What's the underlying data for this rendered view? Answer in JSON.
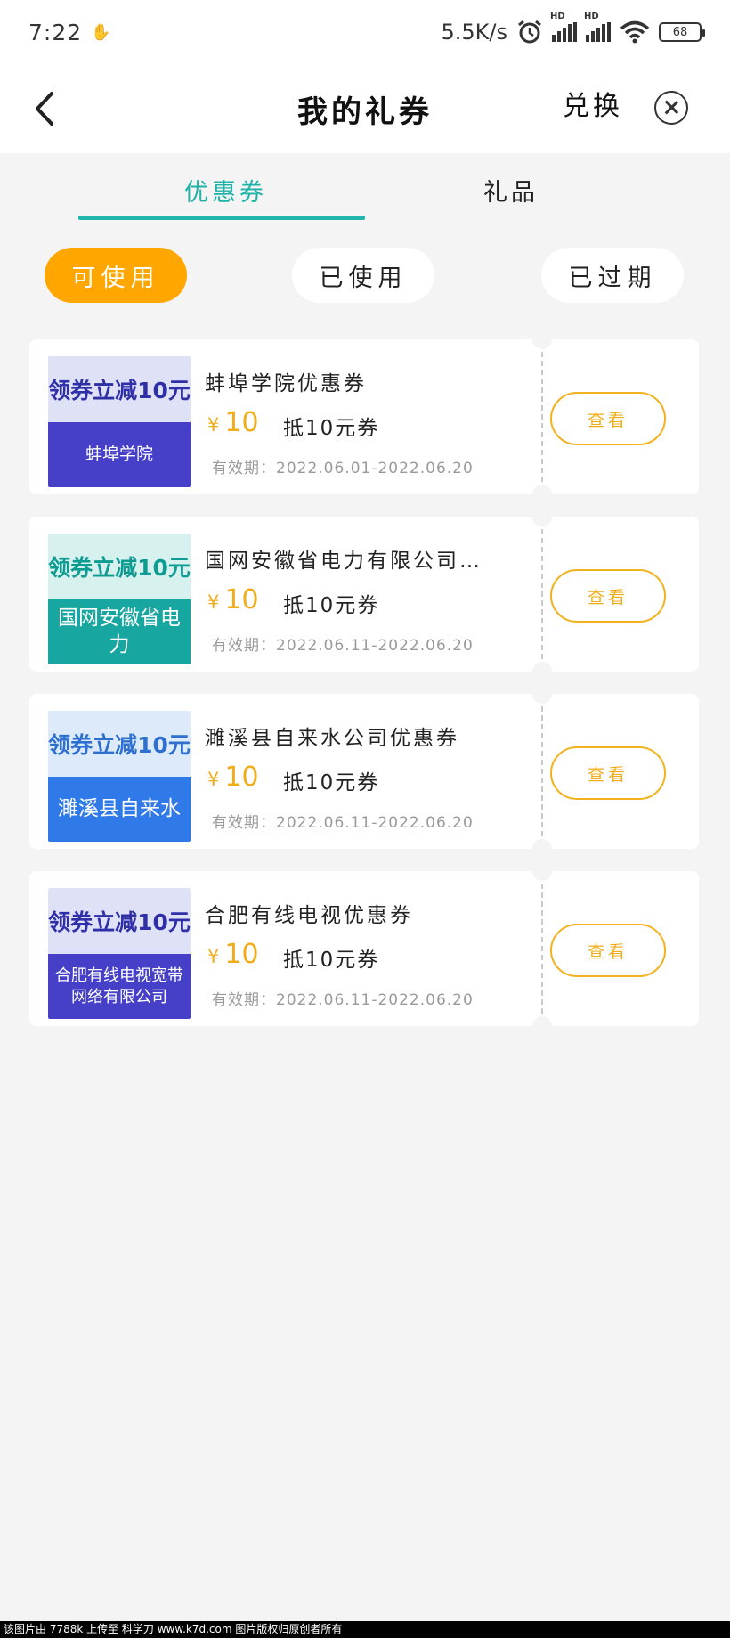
{
  "status_bar": {
    "time": "7:22",
    "speed": "5.5K/s",
    "signal_label_1": "HD",
    "signal_label_2": "HD",
    "battery": "68"
  },
  "header": {
    "title": "我的礼券",
    "exchange_label": "兑换"
  },
  "tabs": [
    {
      "label": "优惠券",
      "active": true
    },
    {
      "label": "礼品",
      "active": false
    }
  ],
  "filters": [
    {
      "label": "可使用",
      "active": true
    },
    {
      "label": "已使用",
      "active": false
    },
    {
      "label": "已过期",
      "active": false
    }
  ],
  "coupons": [
    {
      "thumb_top": "领券立减10元",
      "thumb_bottom": "蚌埠学院",
      "title": "蚌埠学院优惠券",
      "currency": "¥",
      "amount": "10",
      "desc": "抵10元券",
      "valid": "有效期：2022.06.01-2022.06.20",
      "button": "查看"
    },
    {
      "thumb_top": "领券立减10元",
      "thumb_bottom": "国网安徽省电力",
      "title": "国网安徽省电力有限公司…",
      "currency": "¥",
      "amount": "10",
      "desc": "抵10元券",
      "valid": "有效期：2022.06.11-2022.06.20",
      "button": "查看"
    },
    {
      "thumb_top": "领券立减10元",
      "thumb_bottom": "濉溪县自来水",
      "title": "濉溪县自来水公司优惠券",
      "currency": "¥",
      "amount": "10",
      "desc": "抵10元券",
      "valid": "有效期：2022.06.11-2022.06.20",
      "button": "查看"
    },
    {
      "thumb_top": "领券立减10元",
      "thumb_bottom": "合肥有线电视宽带网络有限公司",
      "title": "合肥有线电视优惠券",
      "currency": "¥",
      "amount": "10",
      "desc": "抵10元券",
      "valid": "有效期：2022.06.11-2022.06.20",
      "button": "查看"
    }
  ],
  "watermark": "该图片由 7788k 上传至 科学刀 www.k7d.com 图片版权归原创者所有"
}
